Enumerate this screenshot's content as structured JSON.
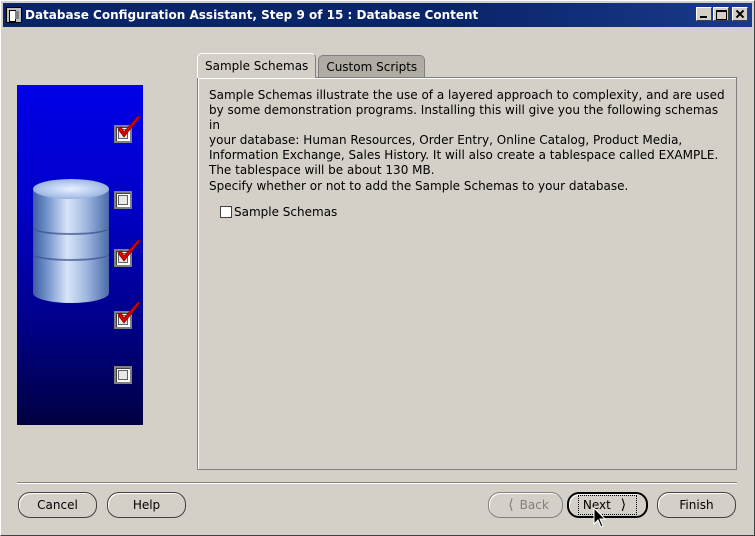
{
  "window": {
    "title": "Database Configuration Assistant, Step 9 of 15 : Database Content"
  },
  "steps": [
    {
      "checked": true
    },
    {
      "checked": false
    },
    {
      "checked": true
    },
    {
      "checked": true
    },
    {
      "checked": false
    }
  ],
  "tabs": [
    {
      "label": "Sample Schemas",
      "active": true
    },
    {
      "label": "Custom Scripts",
      "active": false
    }
  ],
  "content": {
    "description": "Sample Schemas illustrate the use of a layered approach to complexity, and are used\nby some demonstration programs. Installing this will give you the following schemas in\nyour database: Human Resources, Order Entry, Online Catalog, Product Media,\nInformation Exchange, Sales History. It will also create a tablespace called EXAMPLE.\nThe tablespace will be about 130 MB.",
    "prompt": "Specify whether or not to add the Sample Schemas to your database.",
    "checkbox_label": "Sample Schemas",
    "checkbox_checked": false
  },
  "buttons": {
    "cancel": "Cancel",
    "help": "Help",
    "back": "Back",
    "next": "Next",
    "finish": "Finish"
  },
  "colors": {
    "accent_check": "#e00000",
    "title_bar": "#0a246a",
    "panel_blue": "#0000c8"
  }
}
